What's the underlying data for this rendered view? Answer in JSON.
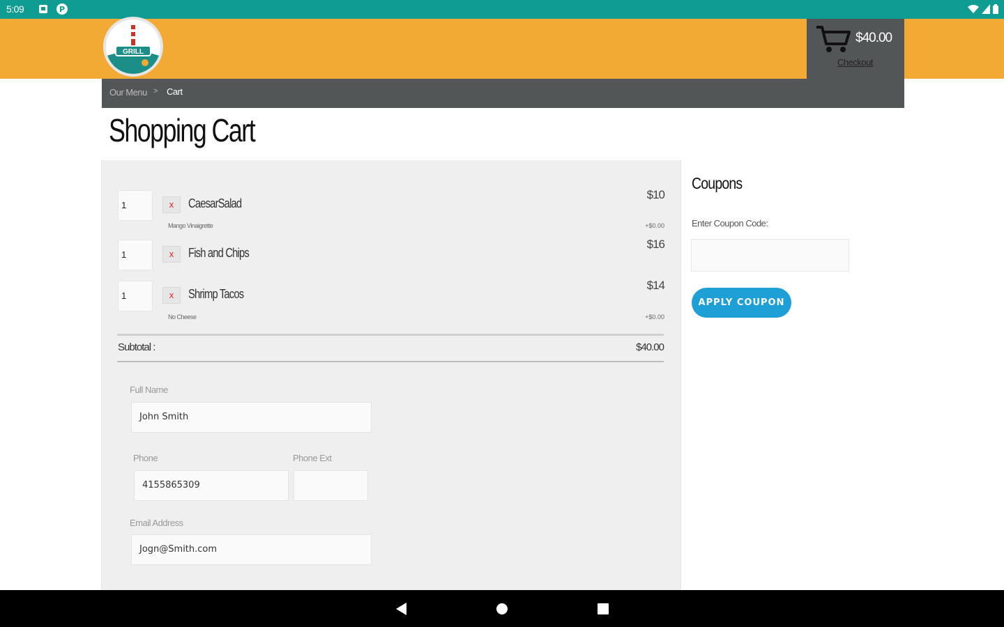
{
  "status_bar": {
    "time": "5:09",
    "icons_left": [
      "notification-box-icon",
      "p-badge-icon"
    ],
    "icons_right": [
      "wifi-icon",
      "signal-icon",
      "battery-icon"
    ]
  },
  "header": {
    "brand_color": "#f2aa35",
    "logo_icon": "lighthouse-logo-icon",
    "logo_text": "GRILL",
    "cart": {
      "total": "$40.00",
      "checkout_label": "Checkout"
    }
  },
  "breadcrumb": {
    "home": "Our Menu",
    "separator": ">",
    "current": "Cart"
  },
  "page_title": "Shopping Cart",
  "cart": {
    "items": [
      {
        "qty": "1",
        "name": "CaesarSalad",
        "note": "Mango Vinaigrette",
        "price": "$10",
        "extra": "+$0.00"
      },
      {
        "qty": "1",
        "name": "Fish and Chips",
        "note": "",
        "price": "$16",
        "extra": ""
      },
      {
        "qty": "1",
        "name": "Shrimp Tacos",
        "note": "No Cheese",
        "price": "$14",
        "extra": "+$0.00"
      }
    ],
    "remove_symbol": "x",
    "subtotal_label": "Subtotal :",
    "subtotal_value": "$40.00"
  },
  "form": {
    "full_name_label": "Full Name",
    "full_name_value": "John Smith",
    "phone_label": "Phone",
    "phone_value": "4155865309",
    "phone_ext_label": "Phone Ext",
    "phone_ext_value": "",
    "email_label": "Email Address",
    "email_value": "Jogn@Smith.com"
  },
  "coupons": {
    "title": "Coupons",
    "input_label": "Enter Coupon Code:",
    "input_value": "",
    "apply_label": "APPLY COUPON",
    "button_color": "#1e9fd6"
  },
  "nav": {
    "icons": [
      "back-icon",
      "home-icon",
      "recents-icon"
    ]
  }
}
